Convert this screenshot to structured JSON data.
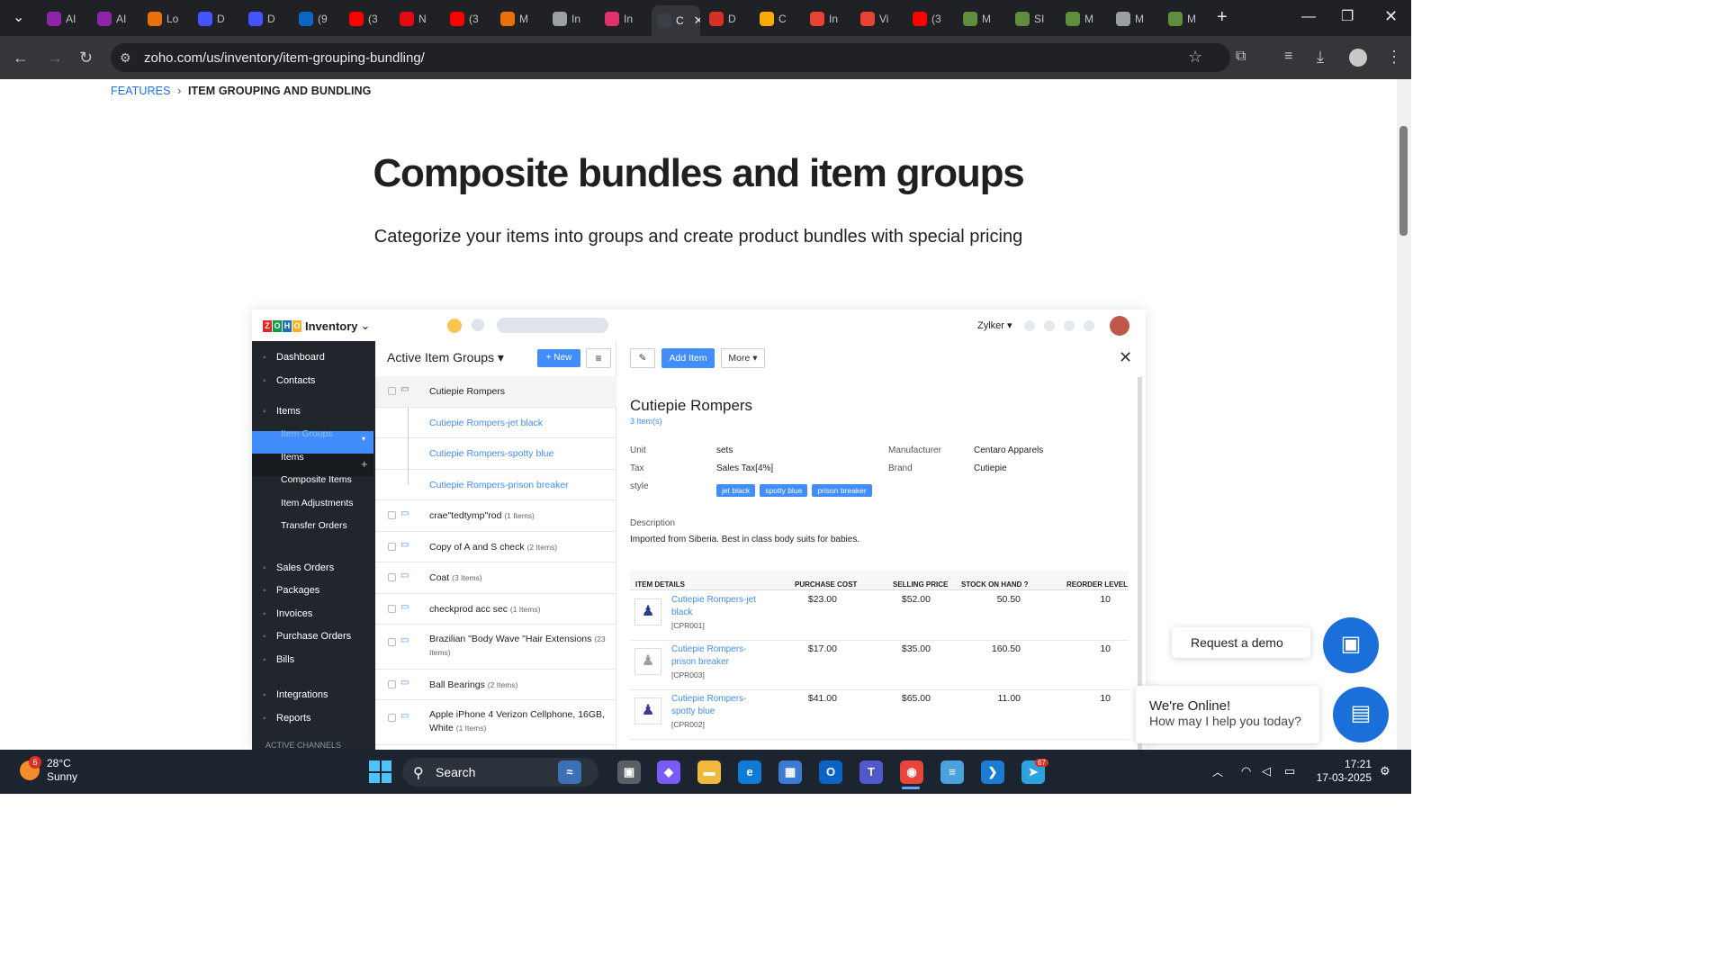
{
  "browser": {
    "tabs": [
      {
        "label": "AI",
        "icon": "u-icon",
        "color": "#8e24aa"
      },
      {
        "label": "AI",
        "icon": "u-icon",
        "color": "#8e24aa"
      },
      {
        "label": "Lo",
        "icon": "grid-icon",
        "color": "#e8710a"
      },
      {
        "label": "D",
        "icon": "webflow-icon",
        "color": "#4353ff"
      },
      {
        "label": "D",
        "icon": "webflow-icon",
        "color": "#4353ff"
      },
      {
        "label": "(9",
        "icon": "linkedin-icon",
        "color": "#0a66c2"
      },
      {
        "label": "(3",
        "icon": "youtube-icon",
        "color": "#ff0000"
      },
      {
        "label": "N",
        "icon": "netflix-icon",
        "color": "#e50914"
      },
      {
        "label": "(3",
        "icon": "youtube-icon",
        "color": "#ff0000"
      },
      {
        "label": "M",
        "icon": "grid-icon",
        "color": "#e8710a"
      },
      {
        "label": "In",
        "icon": "globe-icon",
        "color": "#9aa0a6"
      },
      {
        "label": "In",
        "icon": "instagram-icon",
        "color": "#e1306c"
      },
      {
        "label": "C",
        "icon": "zoho-icon",
        "color": "#3b3f45"
      },
      {
        "label": "D",
        "icon": "news-icon",
        "color": "#d93025"
      },
      {
        "label": "C",
        "icon": "box-icon",
        "color": "#f9ab00"
      },
      {
        "label": "In",
        "icon": "gmail-icon",
        "color": "#ea4335"
      },
      {
        "label": "Vi",
        "icon": "gmail-icon",
        "color": "#ea4335"
      },
      {
        "label": "(3",
        "icon": "youtube-icon",
        "color": "#ff0000"
      },
      {
        "label": "M",
        "icon": "shopify-icon",
        "color": "#5e8e3e"
      },
      {
        "label": "SI",
        "icon": "shopify-icon",
        "color": "#5e8e3e"
      },
      {
        "label": "M",
        "icon": "shopify-icon",
        "color": "#5e8e3e"
      },
      {
        "label": "M",
        "icon": "globe-icon",
        "color": "#9aa0a6"
      },
      {
        "label": "M",
        "icon": "shopify-icon",
        "color": "#5e8e3e"
      }
    ],
    "url": "zoho.com/us/inventory/item-grouping-bundling/"
  },
  "page": {
    "breadcrumb_link": "FEATURES",
    "breadcrumb_sep": "›",
    "breadcrumb_current": "ITEM GROUPING AND BUNDLING",
    "title": "Composite bundles and item groups",
    "subtitle": "Categorize your items into groups and create product bundles with special pricing"
  },
  "app": {
    "logo": [
      "Z",
      "O",
      "H",
      "O"
    ],
    "product": "Inventory",
    "org": "Zylker",
    "sidebar": [
      {
        "label": "Dashboard",
        "icon": "home-icon"
      },
      {
        "label": "Contacts",
        "icon": "user-icon"
      },
      {
        "label": "Items",
        "icon": "basket-icon"
      },
      {
        "label": "Sales Orders",
        "icon": "cart-icon"
      },
      {
        "label": "Packages",
        "icon": "package-icon"
      },
      {
        "label": "Invoices",
        "icon": "invoice-icon"
      },
      {
        "label": "Purchase Orders",
        "icon": "purchase-icon"
      },
      {
        "label": "Bills",
        "icon": "bill-icon"
      },
      {
        "label": "Integrations",
        "icon": "integrations-icon"
      },
      {
        "label": "Reports",
        "icon": "reports-icon"
      }
    ],
    "sidebar_sub": [
      "Item Groups",
      "Items",
      "Composite Items",
      "Item Adjustments",
      "Transfer Orders"
    ],
    "active_channels": "ACTIVE CHANNELS",
    "list_title": "Active Item Groups",
    "new_btn": "New",
    "groups": [
      {
        "name": "Cutiepie Rompers",
        "count": ""
      },
      {
        "name": "Cutiepie Rompers-jet black",
        "count": ""
      },
      {
        "name": "Cutiepie Rompers-spotty blue",
        "count": ""
      },
      {
        "name": "Cutiepie Rompers-prison breaker",
        "count": ""
      },
      {
        "name": "crae\"tedtymp\"rod",
        "count": "(1 Items)"
      },
      {
        "name": "Copy of A and S check",
        "count": "(2 Items)"
      },
      {
        "name": "Coat",
        "count": "(3 Items)"
      },
      {
        "name": "checkprod acc sec",
        "count": "(1 Items)"
      },
      {
        "name": "Brazilian \"Body Wave \"Hair Extensions",
        "count": "(23 Items)"
      },
      {
        "name": "Ball Bearings",
        "count": "(2 Items)"
      },
      {
        "name": "Apple iPhone 4 Verizon Cellphone, 16GB, White",
        "count": "(1 Items)"
      }
    ],
    "detail": {
      "add_item": "Add Item",
      "more": "More",
      "title": "Cutiepie Rompers",
      "count": "3 Item(s)",
      "unit_label": "Unit",
      "unit": "sets",
      "tax_label": "Tax",
      "tax": "Sales Tax[4%]",
      "style_label": "style",
      "styles": [
        "jet black",
        "spotty blue",
        "prison breaker"
      ],
      "manufacturer_label": "Manufacturer",
      "manufacturer": "Centaro Apparels",
      "brand_label": "Brand",
      "brand": "Cutiepie",
      "desc_label": "Description",
      "description": "Imported from Siberia. Best in class body suits for babies.",
      "columns": [
        "ITEM DETAILS",
        "PURCHASE COST",
        "SELLING PRICE",
        "STOCK ON HAND",
        "REORDER LEVEL"
      ],
      "items": [
        {
          "name1": "Cutiepie Rompers-jet",
          "name2": "black",
          "sku": "[CPR001]",
          "cost": "$23.00",
          "price": "$52.00",
          "stock": "50.50",
          "reorder": "10",
          "color": "#2a3b8f"
        },
        {
          "name1": "Cutiepie Rompers-",
          "name2": "prison breaker",
          "sku": "[CPR003]",
          "cost": "$17.00",
          "price": "$35.00",
          "stock": "160.50",
          "reorder": "10",
          "color": "#9aa0a6"
        },
        {
          "name1": "Cutiepie Rompers-",
          "name2": "spotty blue",
          "sku": "[CPR002]",
          "cost": "$41.00",
          "price": "$65.00",
          "stock": "11.00",
          "reorder": "10",
          "color": "#3a3a9a"
        }
      ]
    }
  },
  "widgets": {
    "demo": "Request a demo",
    "online_title": "We're Online!",
    "online_sub": "How may I help you today?"
  },
  "taskbar": {
    "temp": "28°C",
    "weather": "Sunny",
    "weather_badge": "6",
    "search": "Search",
    "time": "17:21",
    "date": "17-03-2025",
    "telegram_badge": "67"
  }
}
